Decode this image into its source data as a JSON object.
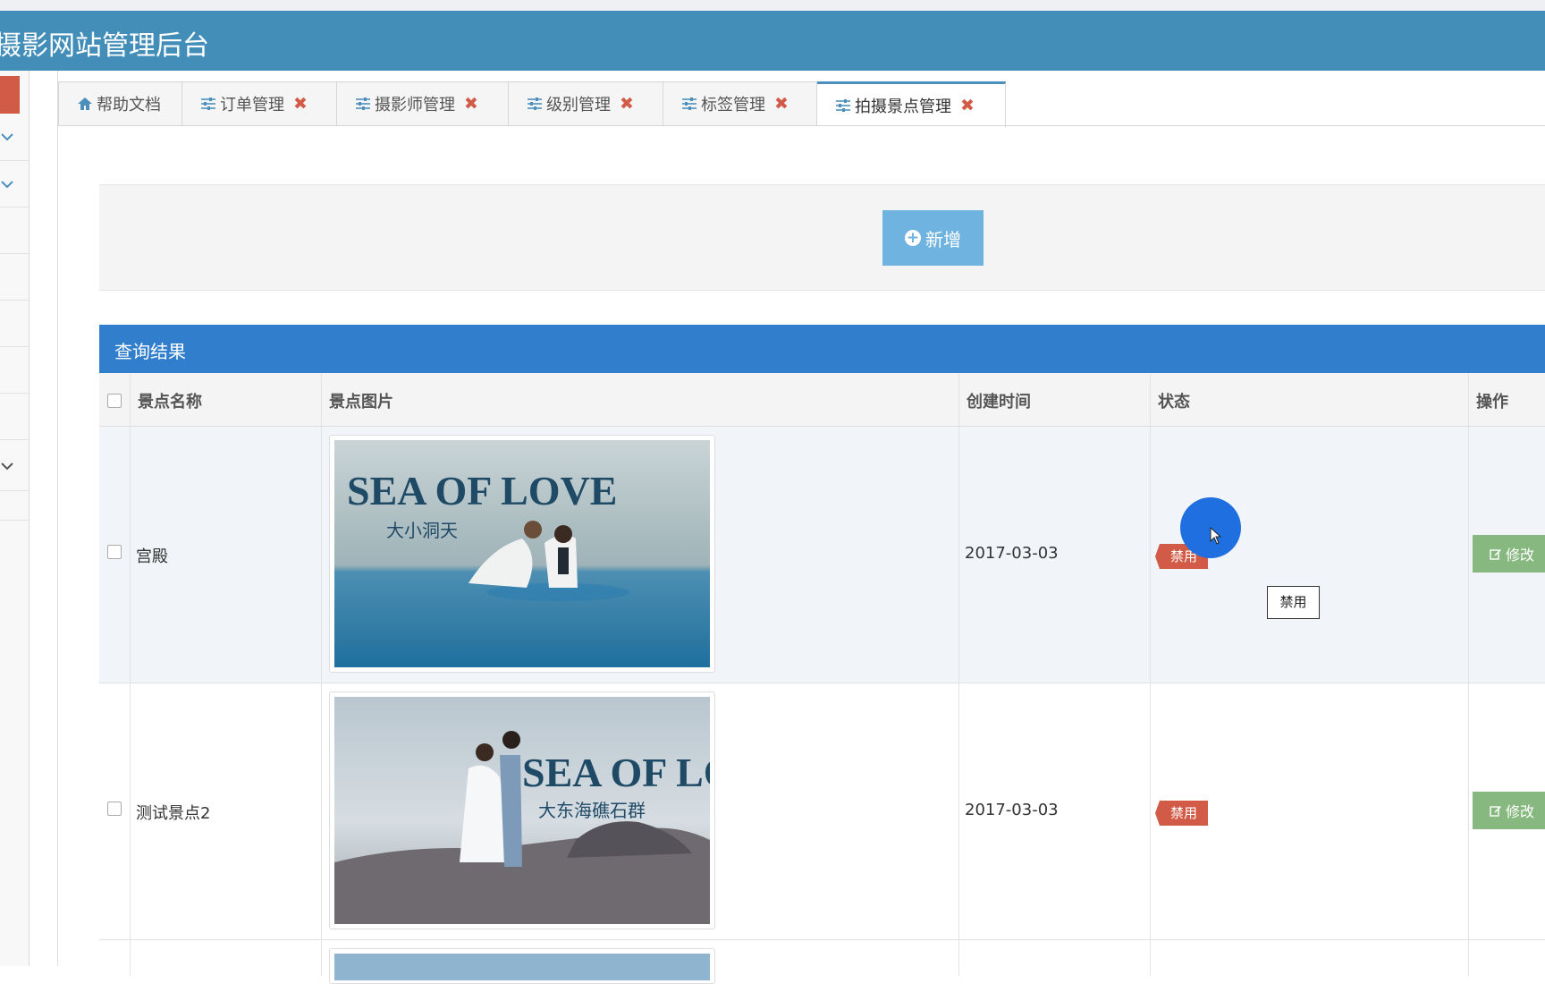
{
  "header": {
    "title": "摄影网站管理后台"
  },
  "tabs": [
    {
      "label": "帮助文档",
      "icon": "home-icon",
      "closable": false,
      "active": false
    },
    {
      "label": "订单管理",
      "icon": "sliders-icon",
      "closable": true,
      "active": false
    },
    {
      "label": "摄影师管理",
      "icon": "sliders-icon",
      "closable": true,
      "active": false
    },
    {
      "label": "级别管理",
      "icon": "sliders-icon",
      "closable": true,
      "active": false
    },
    {
      "label": "标签管理",
      "icon": "sliders-icon",
      "closable": true,
      "active": false
    },
    {
      "label": "拍摄景点管理",
      "icon": "sliders-icon",
      "closable": true,
      "active": true
    }
  ],
  "toolbar": {
    "add_label": "新增"
  },
  "results": {
    "title": "查询结果",
    "columns": [
      "景点名称",
      "景点图片",
      "创建时间",
      "状态",
      "操作"
    ],
    "rows": [
      {
        "name": "宫殿",
        "image_text": "SEA OF LOVE",
        "image_subtitle": "大小洞天",
        "created": "2017-03-03",
        "status": "禁用",
        "action": "修改"
      },
      {
        "name": "测试景点2",
        "image_text": "SEA OF LOVE",
        "image_subtitle": "大东海礁石群",
        "created": "2017-03-03",
        "status": "禁用",
        "action": "修改"
      }
    ]
  },
  "tooltip": {
    "text": "禁用"
  },
  "colors": {
    "header": "#438eb9",
    "results_bar": "#307ecc",
    "add_button": "#6fb3e0",
    "badge": "#d15b47",
    "edit_button": "#87b87f"
  }
}
